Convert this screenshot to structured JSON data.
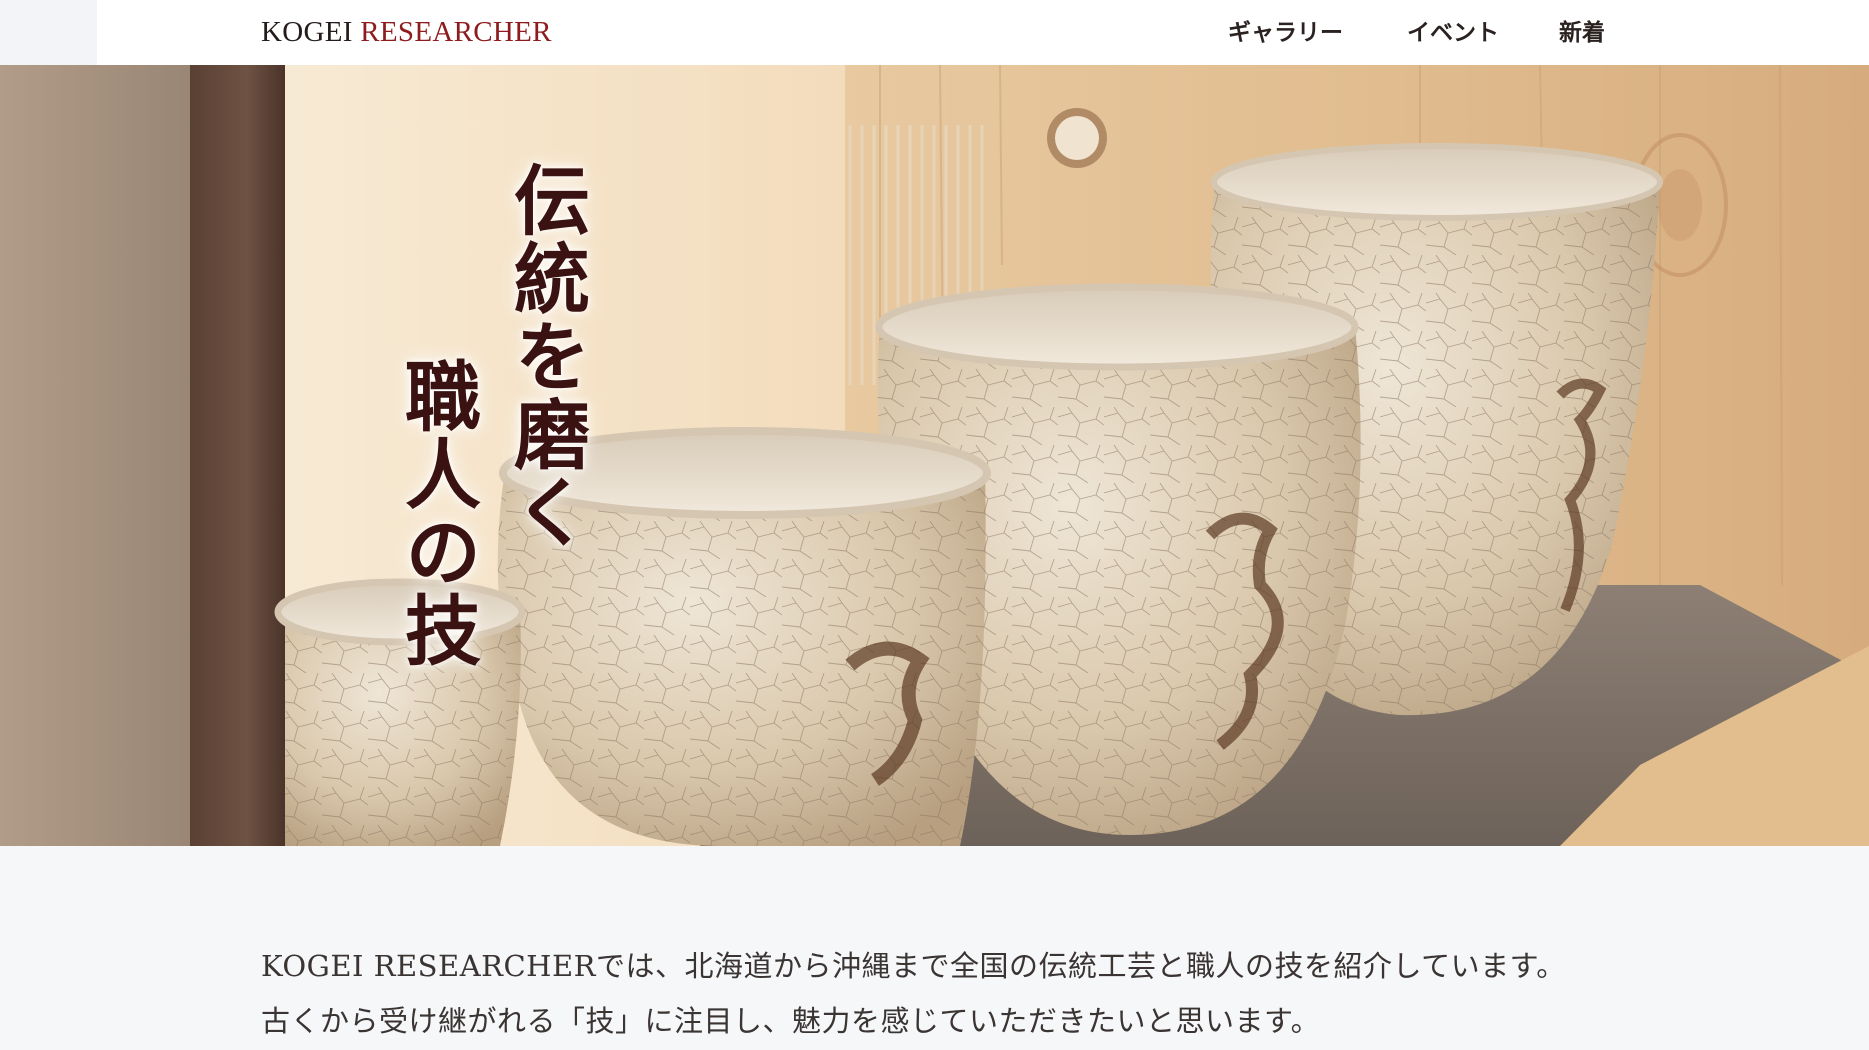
{
  "header": {
    "logo_part1": "KOGEI",
    "logo_part2": "RESEARCHER",
    "nav": [
      {
        "label": "ギャラリー"
      },
      {
        "label": "イベント"
      },
      {
        "label": "新着"
      }
    ]
  },
  "hero": {
    "line1": "伝統を磨く",
    "line2": "職人の技"
  },
  "intro": {
    "paragraph1": "KOGEI RESEARCHERでは、北海道から沖縄まで全国の伝統工芸と職人の技を紹介しています。",
    "paragraph2": "古くから受け継がれる「技」に注目し、魅力を感じていただきたいと思います。"
  },
  "colors": {
    "accent": "#8e1b1d",
    "text": "#231c1a",
    "hero_text": "#3a1212",
    "background": "#f6f7f9"
  }
}
